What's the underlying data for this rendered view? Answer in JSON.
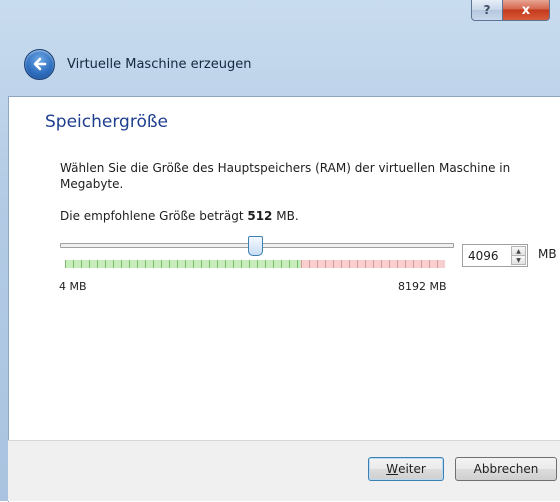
{
  "window": {
    "title": "Virtuelle Maschine erzeugen",
    "help_glyph": "?",
    "close_glyph": "x"
  },
  "page": {
    "heading": "Speichergröße",
    "description": "Wählen Sie die Größe des Hauptspeichers (RAM) der virtuellen Maschine in Megabyte.",
    "recommend_prefix": "Die empfohlene Größe beträgt ",
    "recommend_value": "512",
    "recommend_suffix": " MB."
  },
  "memory": {
    "value": "4096",
    "unit": "MB",
    "slider_min_label": "4 MB",
    "slider_max_label": "8192 MB",
    "slider_level": 0.5
  },
  "buttons": {
    "next_underlined": "W",
    "next_rest": "eiter",
    "cancel": "Abbrechen"
  },
  "icons": {
    "back": "back-arrow-icon",
    "spin_up": "chevron-up-icon",
    "spin_down": "chevron-down-icon"
  },
  "colors": {
    "heading": "#1e3f8f",
    "slider_safe": "#c7edbd",
    "slider_warn": "#f7cfcf"
  }
}
